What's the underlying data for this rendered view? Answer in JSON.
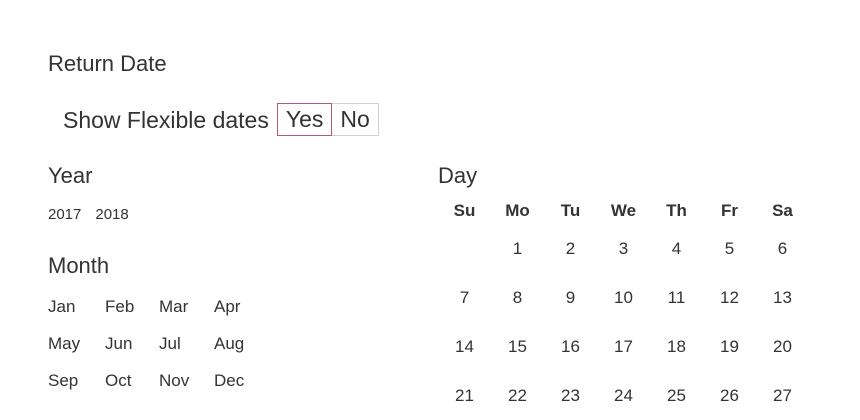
{
  "header": {
    "title": "Return Date"
  },
  "flexible": {
    "label": "Show Flexible dates",
    "options": [
      "Yes",
      "No"
    ],
    "selected": "Yes"
  },
  "year": {
    "title": "Year",
    "options": [
      "2017",
      "2018"
    ]
  },
  "month": {
    "title": "Month",
    "options": [
      "Jan",
      "Feb",
      "Mar",
      "Apr",
      "May",
      "Jun",
      "Jul",
      "Aug",
      "Sep",
      "Oct",
      "Nov",
      "Dec"
    ]
  },
  "day": {
    "title": "Day",
    "weekdays": [
      "Su",
      "Mo",
      "Tu",
      "We",
      "Th",
      "Fr",
      "Sa"
    ],
    "weeks": [
      [
        "",
        "1",
        "2",
        "3",
        "4",
        "5",
        "6"
      ],
      [
        "7",
        "8",
        "9",
        "10",
        "11",
        "12",
        "13"
      ],
      [
        "14",
        "15",
        "16",
        "17",
        "18",
        "19",
        "20"
      ],
      [
        "21",
        "22",
        "23",
        "24",
        "25",
        "26",
        "27"
      ]
    ]
  },
  "colors": {
    "selected_border": "#b45a6b",
    "border": "#d0d0d0",
    "text": "#333333"
  }
}
